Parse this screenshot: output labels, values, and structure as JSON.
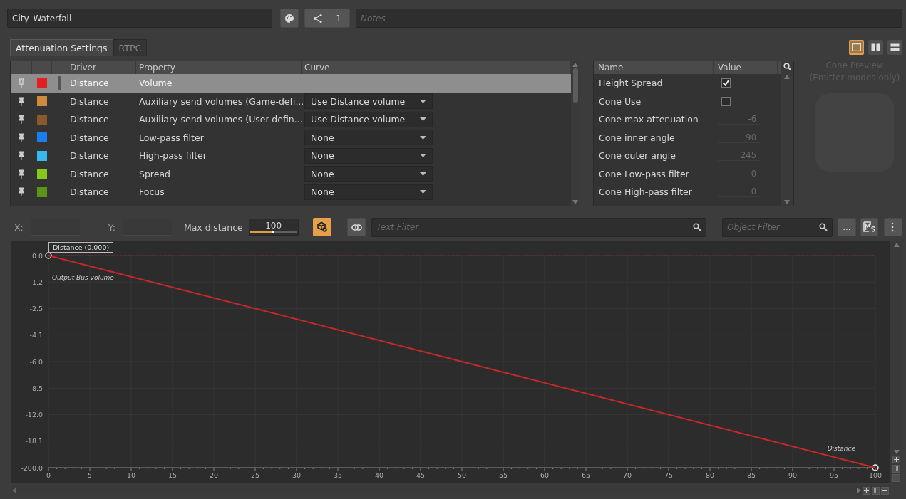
{
  "header": {
    "name": "City_Waterfall",
    "share_count": "1",
    "notes_placeholder": "Notes"
  },
  "tabs": [
    {
      "label": "Attenuation Settings",
      "selected": true
    },
    {
      "label": "RTPC",
      "selected": false
    }
  ],
  "view_modes": [
    {
      "selected": true
    },
    {
      "selected": false
    },
    {
      "selected": false
    }
  ],
  "curves_table": {
    "columns": [
      "Driver",
      "Property",
      "Curve"
    ],
    "rows": [
      {
        "color": "#e02020",
        "driver": "Distance",
        "property": "Volume",
        "selected": true
      },
      {
        "color": "#d08a3c",
        "driver": "Distance",
        "property": "Auxiliary send volumes (Game-defi...",
        "curve": "Use Distance volume",
        "selected": false
      },
      {
        "color": "#8a5a2c",
        "driver": "Distance",
        "property": "Auxiliary send volumes (User-defin...",
        "curve": "Use Distance volume",
        "selected": false
      },
      {
        "color": "#1a7ef0",
        "driver": "Distance",
        "property": "Low-pass filter",
        "curve": "None",
        "selected": false
      },
      {
        "color": "#36b8f0",
        "driver": "Distance",
        "property": "High-pass filter",
        "curve": "None",
        "selected": false
      },
      {
        "color": "#86c81a",
        "driver": "Distance",
        "property": "Spread",
        "curve": "None",
        "selected": false
      },
      {
        "color": "#5c9418",
        "driver": "Distance",
        "property": "Focus",
        "curve": "None",
        "selected": false
      }
    ]
  },
  "cone_table": {
    "columns": [
      "Name",
      "Value"
    ],
    "rows": [
      {
        "name": "Height Spread",
        "kind": "checkbox",
        "checked": true
      },
      {
        "name": "Cone Use",
        "kind": "checkbox",
        "checked": false
      },
      {
        "name": "Cone max attenuation",
        "kind": "number",
        "value": "-6",
        "disabled": true
      },
      {
        "name": "Cone inner angle",
        "kind": "number",
        "value": "90",
        "disabled": true
      },
      {
        "name": "Cone outer angle",
        "kind": "number",
        "value": "245",
        "disabled": true
      },
      {
        "name": "Cone Low-pass filter",
        "kind": "number",
        "value": "0",
        "disabled": true
      },
      {
        "name": "Cone High-pass filter",
        "kind": "number",
        "value": "0",
        "disabled": true
      }
    ]
  },
  "cone_preview": {
    "title": "Cone Preview",
    "subtitle": "(Emitter modes only)"
  },
  "toolbar": {
    "x_label": "X:",
    "y_label": "Y:",
    "max_distance_label": "Max distance",
    "max_distance": "100",
    "max_distance_slider": {
      "level": 0.5
    },
    "text_filter_placeholder": "Text Filter",
    "object_filter_placeholder": "Object Filter",
    "more_label": "..."
  },
  "graph": {
    "point_tooltip": "Distance (0.000)",
    "end_label": "Distance",
    "y_axis_labels": [
      "-1.2",
      "-2.5",
      "-4.1",
      "-6.0",
      "-8.5",
      "-12.0",
      "-18.1"
    ],
    "chart_data": {
      "type": "line",
      "x": [
        0,
        100
      ],
      "series": [
        {
          "name": "Output Bus volume",
          "color": "#c82828",
          "marker": true,
          "values": [
            0.0,
            -200.0
          ]
        }
      ],
      "xlim": [
        0,
        100
      ],
      "ylim": [
        -200.0,
        0.0
      ],
      "yticks": [
        {
          "value": 0.0,
          "label": "0.0"
        },
        {
          "value": -200.0,
          "label": "-200.0"
        }
      ],
      "xticks": [
        0,
        5,
        10,
        15,
        20,
        25,
        30,
        35,
        40,
        45,
        50,
        55,
        60,
        65,
        70,
        75,
        80,
        85,
        90,
        95,
        100
      ]
    }
  }
}
